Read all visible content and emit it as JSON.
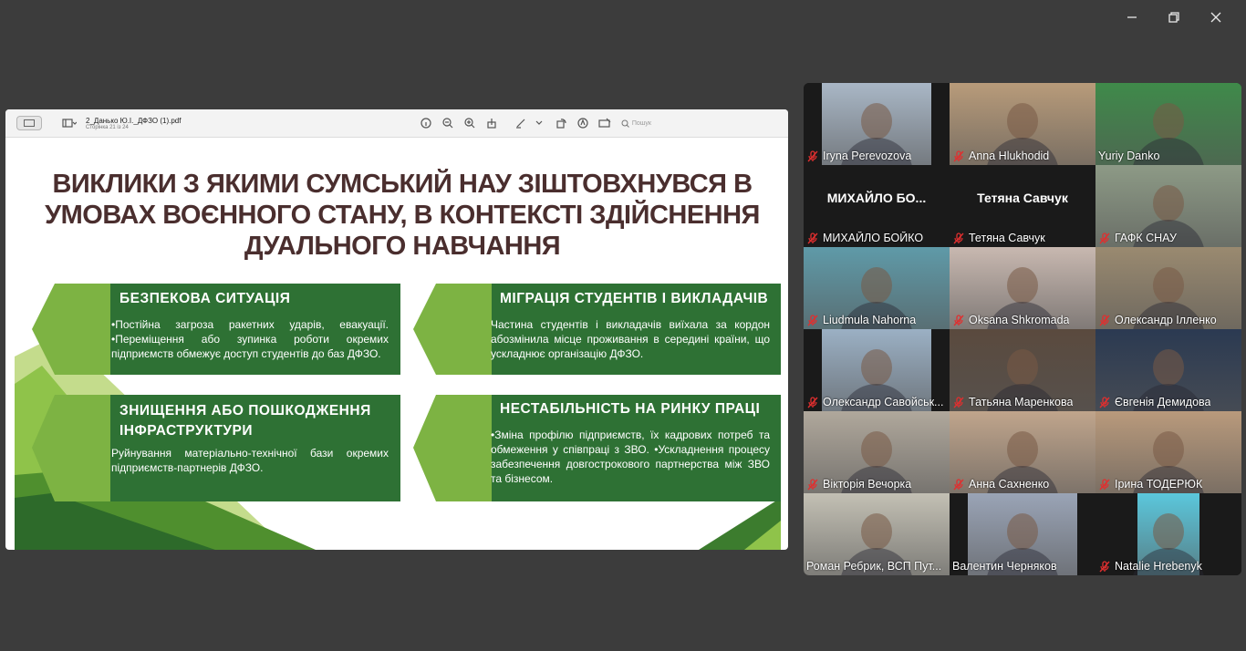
{
  "window_controls": [
    "minimize",
    "restore",
    "close"
  ],
  "pdf": {
    "filename": "2_Данько Ю.І._ДФЗО (1).pdf",
    "page_info": "Сторінка 21 із 24",
    "search_placeholder": "Пошук"
  },
  "slide": {
    "title_line1": "ВИКЛИКИ З ЯКИМИ СУМСЬКИЙ НАУ ЗІШТОВХНУВСЯ В",
    "title_line2": "УМОВАХ ВОЄННОГО СТАНУ, В КОНТЕКСТІ ЗДІЙСНЕННЯ",
    "title_line3": "ДУАЛЬНОГО НАВЧАННЯ",
    "cards": [
      {
        "title": "БЕЗПЕКОВА СИТУАЦІЯ",
        "text": "•Постійна загроза ракетних ударів, евакуації. •Переміщення або зупинка роботи окремих підприємств обмежує доступ студентів до баз ДФЗО."
      },
      {
        "title": "МІГРАЦІЯ СТУДЕНТІВ І ВИКЛАДАЧІВ",
        "text": "Частина студентів і викладачів виїхала за кордон абозмінила місце проживання в середині країни, що ускладнює організацію ДФЗО."
      },
      {
        "title": "ЗНИЩЕННЯ АБО ПОШКОДЖЕННЯ ІНФРАСТРУКТУРИ",
        "text": "Руйнування матеріально-технічної бази окремих підприємств-партнерів ДФЗО."
      },
      {
        "title": "НЕСТАБІЛЬНІСТЬ НА РИНКУ ПРАЦІ",
        "text": "•Зміна профілю підприємств, їх кадрових потреб та обмеження у співпраці з ЗВО. •Ускладнення процесу забезпечення довгострокового партнерства між ЗВО та бізнесом."
      }
    ]
  },
  "participants": [
    {
      "name": "Iryna Perevozova",
      "video": true,
      "bg": "#a9b7c6",
      "muted": true
    },
    {
      "name": "Anna Hlukhodid",
      "video": true,
      "bg": "#b89b7a",
      "muted": true
    },
    {
      "name": "Yuriy Danko",
      "video": true,
      "bg": "#3f8a4a",
      "muted": false,
      "active": true
    },
    {
      "name": "МИХАЙЛО БОЙКО",
      "big": "МИХАЙЛО БО...",
      "video": false,
      "muted": true
    },
    {
      "name": "Тетяна Савчук",
      "big": "Тетяна Савчук",
      "video": false,
      "muted": true
    },
    {
      "name": "ГАФК СНАУ",
      "video": true,
      "bg": "#8d9a86",
      "muted": true
    },
    {
      "name": "Liudmula Nahorna",
      "video": true,
      "bg": "#5f9aa8",
      "muted": true
    },
    {
      "name": "Oksana Shkromada",
      "video": true,
      "bg": "#c8b8b0",
      "muted": true
    },
    {
      "name": "Олександр Ілленко",
      "video": true,
      "bg": "#9a8a70",
      "muted": true
    },
    {
      "name": "Олександр Савойськ...",
      "video": true,
      "bg": "#9bb0c4",
      "muted": true
    },
    {
      "name": "Татьяна Маренкова",
      "video": true,
      "bg": "#5a4a3e",
      "muted": true
    },
    {
      "name": "Євгенія Демидова",
      "video": true,
      "bg": "#2b3a52",
      "muted": true
    },
    {
      "name": "Вікторія Вечорка",
      "video": true,
      "bg": "#b0a89c",
      "muted": true
    },
    {
      "name": "Анна Сахненко",
      "video": true,
      "bg": "#c0a58c",
      "muted": true
    },
    {
      "name": "Ірина ТОДЕРЮК",
      "video": true,
      "bg": "#b99a7c",
      "muted": true
    },
    {
      "name": "Роман Ребрик, ВСП Пут...",
      "video": true,
      "bg": "#c3c0b4",
      "muted": false
    },
    {
      "name": "Валентин Черняков",
      "video": true,
      "bg": "#9aa4b6",
      "muted": false
    },
    {
      "name": "Natalie Hrebenyk",
      "video": true,
      "bg": "#5bc7dc",
      "muted": true
    }
  ]
}
